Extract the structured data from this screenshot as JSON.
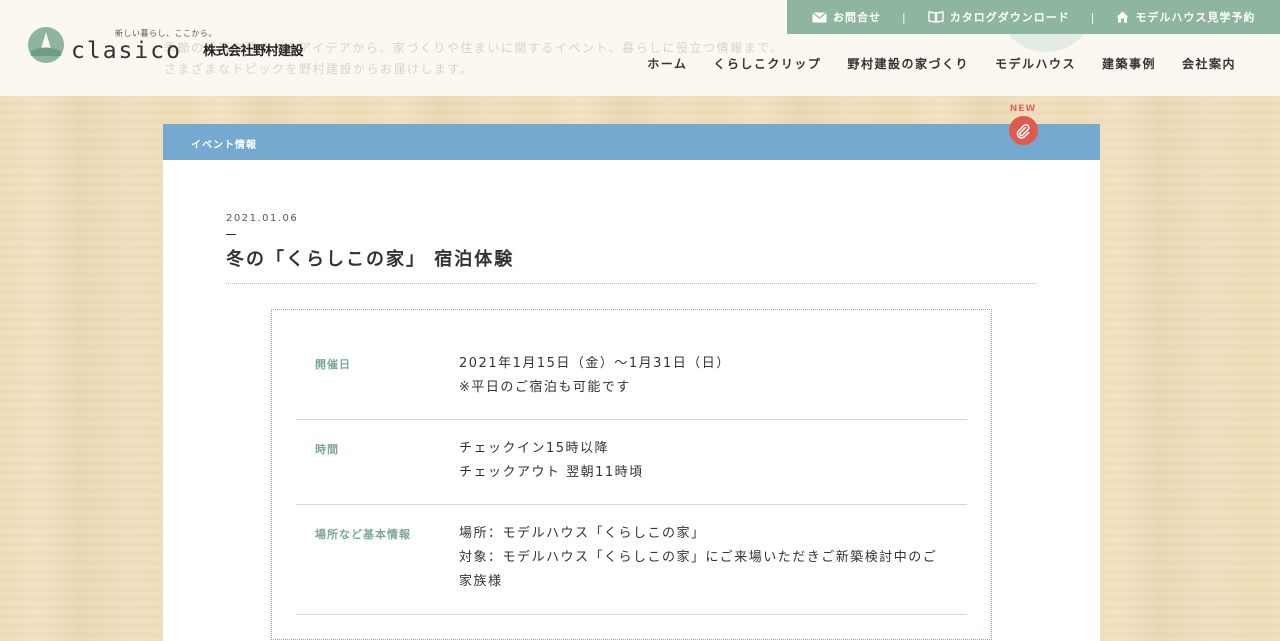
{
  "header": {
    "faded_intro_line1": "季節の行事や暮らしのアイデアから、家づくりや住まいに関するイベント、暮らしに役立つ情報まで。",
    "faded_intro_line2": "さまざまなトピックを野村建設からお届けします。",
    "logo": {
      "tagline": "新しい暮らし、ここから。",
      "wordmark": "clasico",
      "company": "株式会社野村建設"
    },
    "utility": [
      {
        "label": "お問合せ",
        "icon": "mail-icon"
      },
      {
        "label": "カタログダウンロード",
        "icon": "book-icon"
      },
      {
        "label": "モデルハウス見学予約",
        "icon": "house-icon"
      }
    ],
    "utility_separator": "|",
    "nav": [
      {
        "label": "ホーム"
      },
      {
        "label": "くらしこクリップ"
      },
      {
        "label": "野村建設の家づくり"
      },
      {
        "label": "モデルハウス"
      },
      {
        "label": "建築事例"
      },
      {
        "label": "会社案内"
      }
    ]
  },
  "card": {
    "category": "イベント情報",
    "new_badge": "NEW",
    "date": "2021.01.06",
    "title": "冬の「くらしこの家」 宿泊体験",
    "details": [
      {
        "label": "開催日",
        "lines": [
          "2021年1月15日（金）〜1月31日（日）",
          "※平日のご宿泊も可能です"
        ]
      },
      {
        "label": "時間",
        "lines": [
          "チェックイン15時以降",
          "チェックアウト 翌朝11時頃"
        ]
      },
      {
        "label": "場所など基本情報",
        "lines": [
          "場所：モデルハウス「くらしこの家」",
          "対象：モデルハウス「くらしこの家」にご来場いただきご新築検討中のご",
          "家族様"
        ]
      }
    ]
  },
  "colors": {
    "utility_bar": "#8db5a0",
    "category_bar": "#76a9cf",
    "new_badge": "#e05a4f",
    "detail_label": "#7ea899"
  }
}
